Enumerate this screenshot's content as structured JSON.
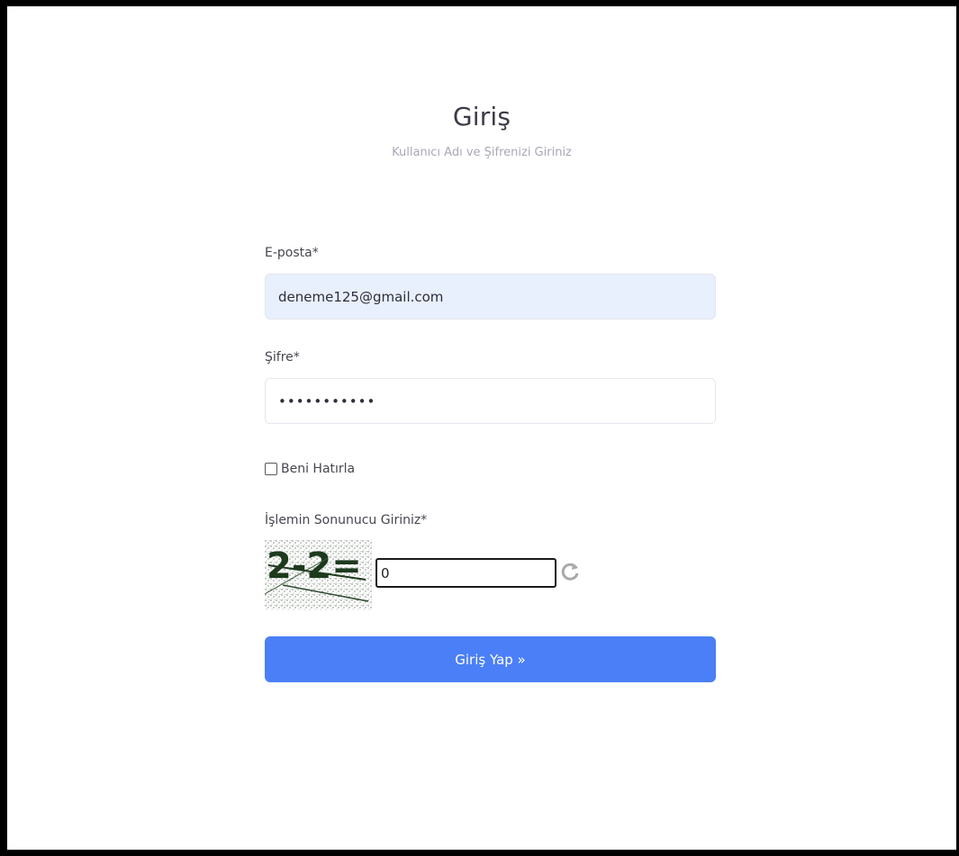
{
  "header": {
    "title": "Giriş",
    "subtitle": "Kullanıcı Adı ve Şifrenizi Giriniz"
  },
  "form": {
    "email": {
      "label": "E-posta*",
      "value": "deneme125@gmail.com"
    },
    "password": {
      "label": "Şifre*",
      "value": "•••••••••••"
    },
    "remember": {
      "label": "Beni Hatırla",
      "checked": false
    },
    "captcha": {
      "label": "İşlemin Sonunucu Giriniz*",
      "image_text": "2-2=",
      "value": "0",
      "refresh_icon": "refresh-icon"
    },
    "submit_label": "Giriş Yap »"
  },
  "colors": {
    "primary": "#4b7ff7",
    "email_bg": "#e8effd",
    "title": "#3b3b48",
    "subtitle": "#a8a8b8",
    "frame": "#000000"
  }
}
